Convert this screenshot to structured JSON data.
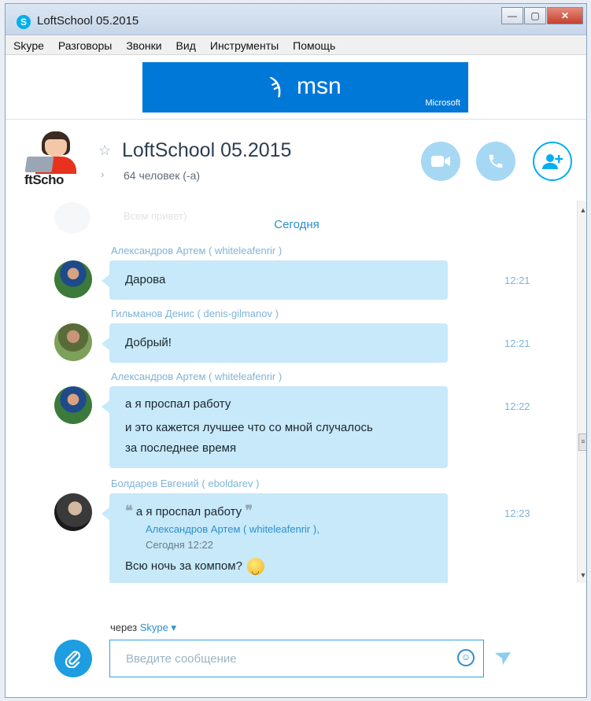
{
  "window": {
    "title": "LoftSchool 05.2015"
  },
  "menu": [
    "Skype",
    "Разговоры",
    "Звонки",
    "Вид",
    "Инструменты",
    "Помощь"
  ],
  "ad": {
    "brand": "msn",
    "company": "Microsoft"
  },
  "chat": {
    "title": "LoftSchool 05.2015",
    "subtitle": "64 человек (-а)",
    "group_avatar_text": "ftScho",
    "date_separator": "Сегодня",
    "ghost_message": "Всем привет)",
    "messages": [
      {
        "sender": "Александров Артем ( whiteleafenrir )",
        "lines": [
          "Дарова"
        ],
        "time": "12:21"
      },
      {
        "sender": "Гильманов Денис ( denis-gilmanov )",
        "lines": [
          "Добрый!"
        ],
        "time": "12:21"
      },
      {
        "sender": "Александров Артем ( whiteleafenrir )",
        "lines": [
          "а я проспал работу",
          "и это кажется лучшее что со мной случалось",
          "за последнее время"
        ],
        "time": "12:22"
      },
      {
        "sender": "Болдарев Евгений ( eboldarev )",
        "quote_text": "а я проспал работу",
        "quote_author": "Александров Артем ( whiteleafenrir ),",
        "quote_time": "Сегодня 12:22",
        "text": "Всю ночь за компом?",
        "time": "12:23"
      }
    ]
  },
  "composer": {
    "via_prefix": "через",
    "via_link": "Skype",
    "placeholder": "Введите сообщение"
  },
  "colors": {
    "accent": "#00aff0",
    "bubble": "#c7e9f9",
    "ad_bg": "#0078d7"
  }
}
